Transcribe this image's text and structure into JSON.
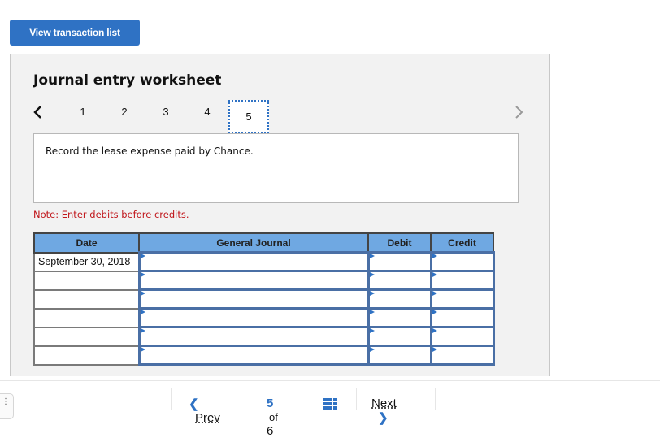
{
  "toolbar": {
    "view_transactions_label": "View transaction list"
  },
  "worksheet": {
    "title": "Journal entry worksheet",
    "steps": [
      "1",
      "2",
      "3",
      "4",
      "5"
    ],
    "active_step": "5",
    "prompt": "Record the lease expense paid by Chance.",
    "note": "Note: Enter debits before credits.",
    "table": {
      "headers": [
        "Date",
        "General Journal",
        "Debit",
        "Credit"
      ],
      "rows": [
        {
          "date": "September 30, 2018",
          "account": "",
          "debit": "",
          "credit": ""
        },
        {
          "date": "",
          "account": "",
          "debit": "",
          "credit": ""
        },
        {
          "date": "",
          "account": "",
          "debit": "",
          "credit": ""
        },
        {
          "date": "",
          "account": "",
          "debit": "",
          "credit": ""
        },
        {
          "date": "",
          "account": "",
          "debit": "",
          "credit": ""
        },
        {
          "date": "",
          "account": "",
          "debit": "",
          "credit": ""
        }
      ]
    }
  },
  "footer": {
    "prev_label": "Prev",
    "current_page": "5",
    "of_label": "of",
    "total_pages": "6",
    "next_label": "Next"
  },
  "colors": {
    "accent": "#2f72c4",
    "header_fill": "#6fa8e2",
    "note": "#c0161b",
    "panel": "#f2f2f2"
  }
}
